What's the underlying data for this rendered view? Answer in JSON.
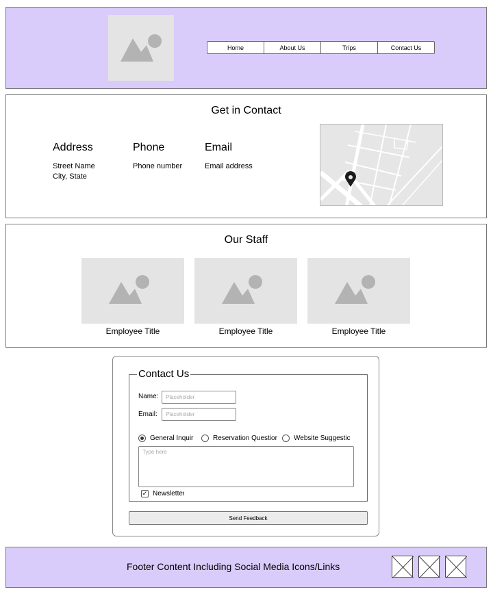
{
  "nav": {
    "items": [
      "Home",
      "About Us",
      "Trips",
      "Contact Us"
    ]
  },
  "contact_info": {
    "title": "Get in Contact",
    "address": {
      "heading": "Address",
      "lines": [
        "Street Name",
        "City, State"
      ]
    },
    "phone": {
      "heading": "Phone",
      "lines": [
        "Phone number"
      ]
    },
    "email": {
      "heading": "Email",
      "lines": [
        "Email address"
      ]
    }
  },
  "staff": {
    "title": "Our Staff",
    "cards": [
      {
        "title": "Employee Title"
      },
      {
        "title": "Employee Title"
      },
      {
        "title": "Employee Title"
      }
    ]
  },
  "form": {
    "legend": "Contact Us",
    "name_label": "Name:",
    "name_placeholder": "Placeholder",
    "email_label": "Email:",
    "email_placeholder": "Placeholder",
    "radios": [
      {
        "label": "General Inquir",
        "selected": true
      },
      {
        "label": "Reservation Questior",
        "selected": false
      },
      {
        "label": "Website Suggestic",
        "selected": false
      }
    ],
    "textarea_placeholder": "Type here",
    "checkbox_label": "Newsletter",
    "checkbox_checked": true,
    "submit_label": "Send Feedback"
  },
  "footer": {
    "text": "Footer Content Including Social Media Icons/Links"
  },
  "colors": {
    "header_bg": "#d9ccfb",
    "placeholder_bg": "#e4e4e4",
    "placeholder_icon": "#b3b3b3"
  }
}
